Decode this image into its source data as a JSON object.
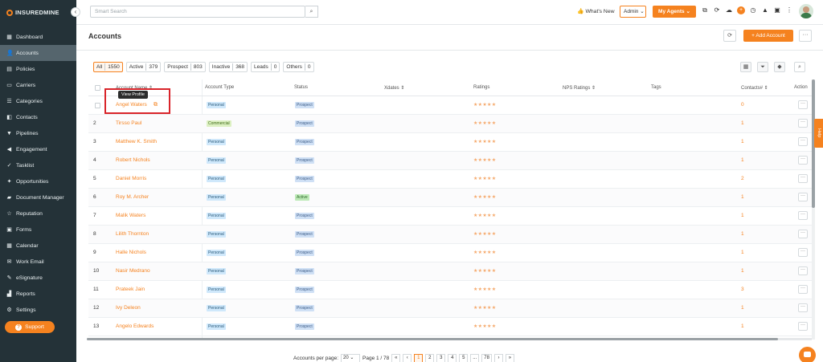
{
  "brand": {
    "name": "INSUREDMINE"
  },
  "sidebar": {
    "items": [
      {
        "label": "Dashboard",
        "icon": "dashboard-icon",
        "glyph": "▦"
      },
      {
        "label": "Accounts",
        "icon": "user-icon",
        "glyph": "👤"
      },
      {
        "label": "Policies",
        "icon": "document-icon",
        "glyph": "▤"
      },
      {
        "label": "Carriers",
        "icon": "briefcase-icon",
        "glyph": "▭"
      },
      {
        "label": "Categories",
        "icon": "list-icon",
        "glyph": "☰"
      },
      {
        "label": "Contacts",
        "icon": "contacts-icon",
        "glyph": "◧"
      },
      {
        "label": "Pipelines",
        "icon": "funnel-icon",
        "glyph": "▼"
      },
      {
        "label": "Engagement",
        "icon": "megaphone-icon",
        "glyph": "◀"
      },
      {
        "label": "Tasklist",
        "icon": "tasklist-icon",
        "glyph": "✓"
      },
      {
        "label": "Opportunities",
        "icon": "opportunity-icon",
        "glyph": "✦"
      },
      {
        "label": "Document Manager",
        "icon": "folder-icon",
        "glyph": "▰"
      },
      {
        "label": "Reputation",
        "icon": "star-icon",
        "glyph": "☆"
      },
      {
        "label": "Forms",
        "icon": "forms-icon",
        "glyph": "▣"
      },
      {
        "label": "Calendar",
        "icon": "calendar-icon",
        "glyph": "▦"
      },
      {
        "label": "Work Email",
        "icon": "mail-icon",
        "glyph": "✉"
      },
      {
        "label": "eSignature",
        "icon": "signature-icon",
        "glyph": "✎"
      },
      {
        "label": "Reports",
        "icon": "chart-icon",
        "glyph": "▟"
      },
      {
        "label": "Settings",
        "icon": "gear-icon",
        "glyph": "⚙"
      }
    ],
    "support_label": "Support"
  },
  "topbar": {
    "search_placeholder": "Smart Search",
    "whats_new": "What's New",
    "admin_label": "Admin",
    "agents_label": "My Agents"
  },
  "page": {
    "title": "Accounts",
    "add_label": "+ Add Account"
  },
  "filters": [
    {
      "label": "All",
      "count": "1550",
      "active": true
    },
    {
      "label": "Active",
      "count": "379"
    },
    {
      "label": "Prospect",
      "count": "803"
    },
    {
      "label": "Inactive",
      "count": "368"
    },
    {
      "label": "Leads",
      "count": "0"
    },
    {
      "label": "Others",
      "count": "0"
    }
  ],
  "table": {
    "headers": {
      "name": "Account Name ⇕",
      "type": "Account Type",
      "status": "Status",
      "xdates": "Xdates ⇕",
      "ratings": "Ratings",
      "nps": "NPS Ratings ⇕",
      "tags": "Tags",
      "contacts": "Contacts# ⇕",
      "action": "Action"
    },
    "tooltip": "View Profile",
    "rows": [
      {
        "num": "",
        "name": "Angel Waters",
        "type": "Personal",
        "status": "Prospect",
        "rating": "★★★★★",
        "contacts": "0"
      },
      {
        "num": "2",
        "name": "Tirsso Paul",
        "type": "Commercial",
        "status": "Prospect",
        "rating": "★★★★★",
        "contacts": "1"
      },
      {
        "num": "3",
        "name": "Matthew K. Smith",
        "type": "Personal",
        "status": "Prospect",
        "rating": "★★★★★",
        "contacts": "1"
      },
      {
        "num": "4",
        "name": "Robert Nichols",
        "type": "Personal",
        "status": "Prospect",
        "rating": "★★★★★",
        "contacts": "1"
      },
      {
        "num": "5",
        "name": "Daniel Morris",
        "type": "Personal",
        "status": "Prospect",
        "rating": "★★★★★",
        "contacts": "2"
      },
      {
        "num": "6",
        "name": "Roy M. Archer",
        "type": "Personal",
        "status": "Active",
        "rating": "★★★★★",
        "contacts": "1"
      },
      {
        "num": "7",
        "name": "Malik Waters",
        "type": "Personal",
        "status": "Prospect",
        "rating": "★★★★★",
        "contacts": "1"
      },
      {
        "num": "8",
        "name": "Lilith Thornton",
        "type": "Personal",
        "status": "Prospect",
        "rating": "★★★★★",
        "contacts": "1"
      },
      {
        "num": "9",
        "name": "Halle Nichols",
        "type": "Personal",
        "status": "Prospect",
        "rating": "★★★★★",
        "contacts": "1"
      },
      {
        "num": "10",
        "name": "Nasir Medrano",
        "type": "Personal",
        "status": "Prospect",
        "rating": "★★★★★",
        "contacts": "1"
      },
      {
        "num": "11",
        "name": "Prateek Jain",
        "type": "Personal",
        "status": "Prospect",
        "rating": "★★★★★",
        "contacts": "3"
      },
      {
        "num": "12",
        "name": "Ivy Deleon",
        "type": "Personal",
        "status": "Prospect",
        "rating": "★★★★★",
        "contacts": "1"
      },
      {
        "num": "13",
        "name": "Angelo Edwards",
        "type": "Personal",
        "status": "Prospect",
        "rating": "★★★★★",
        "contacts": "1"
      }
    ]
  },
  "pagination": {
    "per_page_label": "Accounts per page:",
    "per_page_value": "20",
    "page_info": "Page 1 / 78",
    "pages": [
      "«",
      "‹",
      "1",
      "2",
      "3",
      "4",
      "5",
      "...",
      "78",
      "›",
      "»"
    ],
    "current": "1"
  },
  "help_label": "Help",
  "colors": {
    "accent": "#f5821f",
    "sidebar": "#243238",
    "highlight": "#d9242a"
  }
}
